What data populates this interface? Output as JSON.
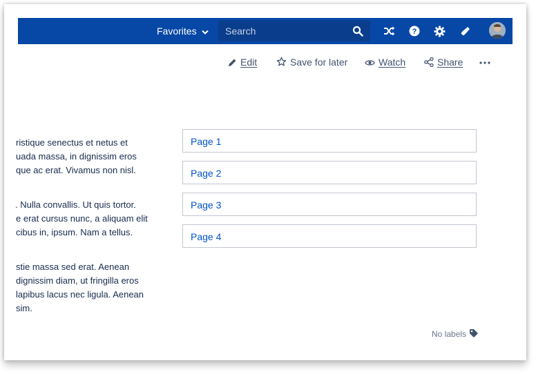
{
  "header": {
    "favorites_label": "Favorites",
    "search_placeholder": "Search",
    "brand_color": "#0747a6"
  },
  "toolbar": {
    "edit_label": "Edit",
    "save_label": "Save for later",
    "watch_label": "Watch",
    "share_label": "Share"
  },
  "content": {
    "paragraphs": [
      [
        "ristique senectus et netus et",
        "uada massa, in dignissim eros",
        "que ac erat. Vivamus non nisl."
      ],
      [
        ". Nulla convallis. Ut quis tortor.",
        "e erat cursus nunc, a aliquam elit",
        "cibus in, ipsum. Nam a tellus."
      ],
      [
        "stie massa sed erat. Aenean",
        "dignissim diam, ut fringilla eros",
        "lapibus lacus nec ligula. Aenean",
        "sim."
      ]
    ],
    "pages": [
      "Page 1",
      "Page 2",
      "Page 3",
      "Page 4"
    ],
    "link_color": "#0052cc"
  },
  "footer": {
    "labels_text": "No labels"
  }
}
